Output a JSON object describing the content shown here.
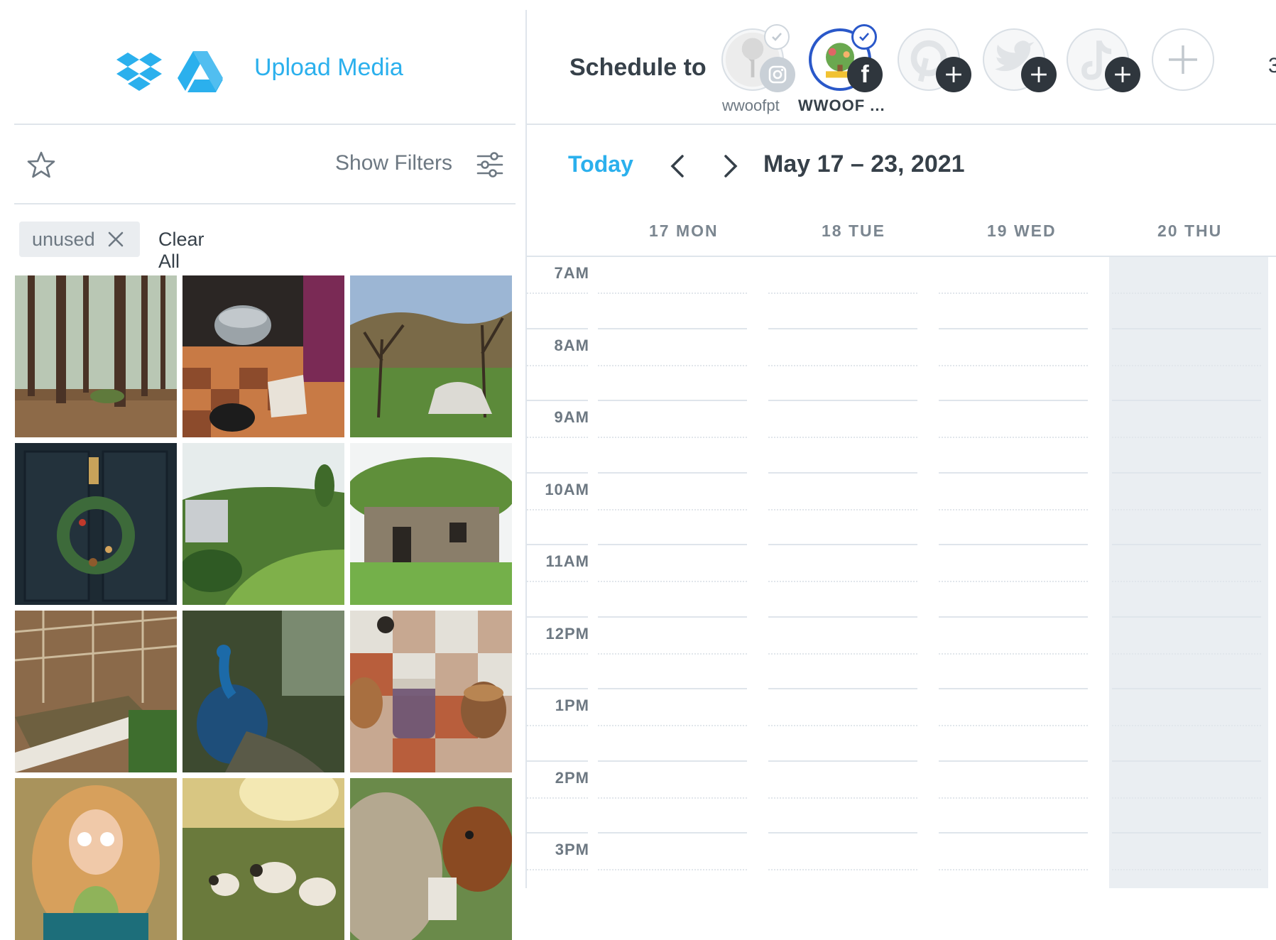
{
  "media_panel": {
    "upload_label": "Upload Media",
    "show_filters_label": "Show Filters",
    "filter_chip": "unused",
    "clear_all_label": "Clear All",
    "icons": [
      "dropbox-icon",
      "google-drive-icon",
      "star-icon",
      "filters-icon",
      "close-icon"
    ]
  },
  "scheduler": {
    "schedule_to_label": "Schedule to",
    "accounts": [
      {
        "name": "wwoofpt",
        "network": "instagram",
        "selected": false
      },
      {
        "name": "WWOOF ...",
        "network": "facebook",
        "selected": true
      },
      {
        "name": "",
        "network": "pinterest",
        "selected": false
      },
      {
        "name": "",
        "network": "twitter",
        "selected": false
      },
      {
        "name": "",
        "network": "tiktok",
        "selected": false
      }
    ],
    "today_label": "Today",
    "date_range": "May 17 – 23, 2021",
    "days": [
      "17 MON",
      "18 TUE",
      "19 WED",
      "20 THU"
    ],
    "hours": [
      "7AM",
      "8AM",
      "9AM",
      "10AM",
      "11AM",
      "12PM",
      "1PM",
      "2PM",
      "3PM"
    ],
    "edge_text": "3"
  },
  "colors": {
    "accent": "#2bb0ed",
    "text": "#364049",
    "muted": "#6d7882",
    "highlight_column": "#eaeef2",
    "facebook_selected_ring": "#2a58c9"
  }
}
